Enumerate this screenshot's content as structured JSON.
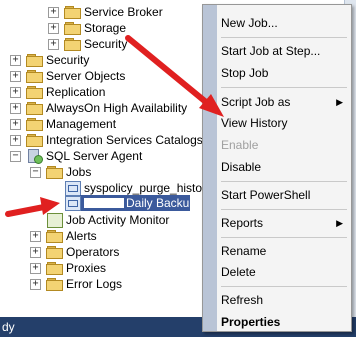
{
  "tree": {
    "items": [
      {
        "label": "Service Broker",
        "expander": "+"
      },
      {
        "label": "Storage",
        "expander": "+"
      },
      {
        "label": "Security",
        "expander": "+"
      },
      {
        "label": "Security",
        "expander": "+"
      },
      {
        "label": "Server Objects",
        "expander": "+"
      },
      {
        "label": "Replication",
        "expander": "+"
      },
      {
        "label": "AlwaysOn High Availability",
        "expander": "+"
      },
      {
        "label": "Management",
        "expander": "+"
      },
      {
        "label": "Integration Services Catalogs",
        "expander": "+"
      },
      {
        "label": "SQL Server Agent",
        "expander": "−"
      },
      {
        "label": "Jobs",
        "expander": "−"
      },
      {
        "label": "syspolicy_purge_histo"
      },
      {
        "label": "Daily Backup"
      },
      {
        "label": "Job Activity Monitor"
      },
      {
        "label": "Alerts",
        "expander": "+"
      },
      {
        "label": "Operators",
        "expander": "+"
      },
      {
        "label": "Proxies",
        "expander": "+"
      },
      {
        "label": "Error Logs",
        "expander": "+"
      }
    ]
  },
  "context_menu": {
    "items": [
      {
        "label": "New Job..."
      },
      {
        "label": "Start Job at Step..."
      },
      {
        "label": "Stop Job"
      },
      {
        "label": "Script Job as",
        "submenu": "▶"
      },
      {
        "label": "View History"
      },
      {
        "label": "Enable"
      },
      {
        "label": "Disable"
      },
      {
        "label": "Start PowerShell"
      },
      {
        "label": "Reports",
        "submenu": "▶"
      },
      {
        "label": "Rename"
      },
      {
        "label": "Delete"
      },
      {
        "label": "Refresh"
      },
      {
        "label": "Properties"
      }
    ]
  },
  "statusbar": {
    "text": "dy"
  },
  "colors": {
    "arrow": "#e02020",
    "selection": "#3b5a9c",
    "statusbar": "#243f6a"
  }
}
